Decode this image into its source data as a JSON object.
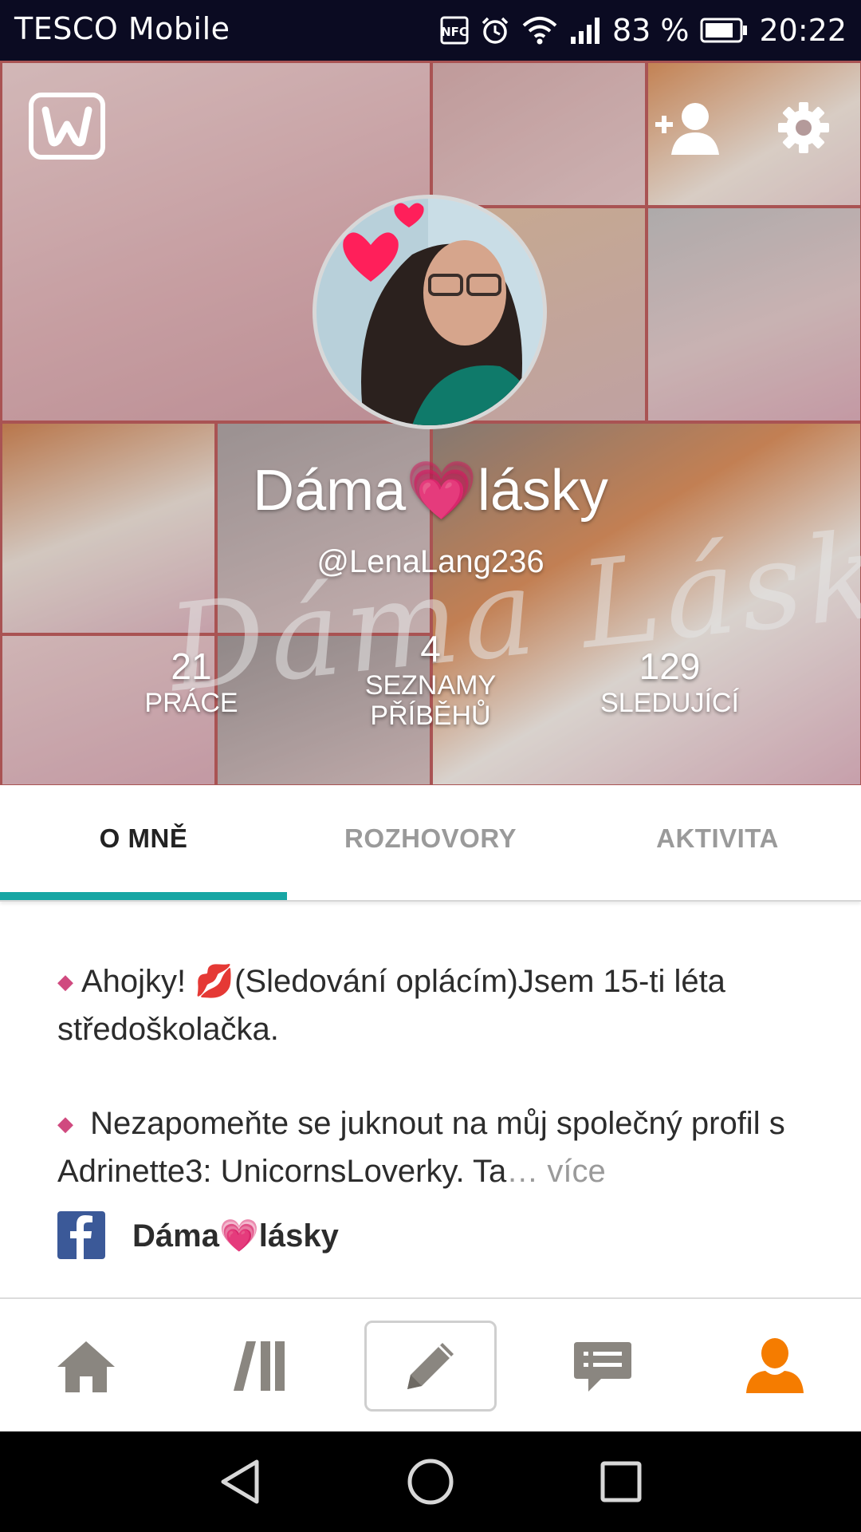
{
  "status_bar": {
    "carrier": "TESCO Mobile",
    "battery": "83 %",
    "time": "20:22",
    "icons": [
      "nfc-icon",
      "alarm-icon",
      "wifi-icon",
      "signal-icon",
      "battery-icon"
    ]
  },
  "header": {
    "logo_icon": "wattpad-logo-icon",
    "add_follow_icon": "add-user-icon",
    "settings_icon": "gear-icon",
    "display_name_prefix": "Dáma",
    "display_name_emoji": "💗",
    "display_name_suffix": "lásky",
    "username": "@LenaLang236",
    "cover_watermark": "Dáma Lásky"
  },
  "stats": [
    {
      "value": "21",
      "label": "PRÁCE"
    },
    {
      "value": "4",
      "label_line1": "SEZNAMY",
      "label_line2": "PŘÍBĚHŮ"
    },
    {
      "value": "129",
      "label": "SLEDUJÍCÍ"
    }
  ],
  "tabs": {
    "items": [
      {
        "label": "O MNĚ"
      },
      {
        "label": "ROZHOVORY"
      },
      {
        "label": "AKTIVITA"
      }
    ],
    "active_index": 0,
    "indicator_color": "#17a6a4"
  },
  "about": {
    "bullet": "◆",
    "paragraph1_start": "Ahojky! ",
    "paragraph1_emoji": "💋",
    "paragraph1_end": "(Sledování oplácím)Jsem 15-ti léta středoškolačka.",
    "paragraph2": " Nezapomeňte se juknout na můj společný profil s Adrinette3: UnicornsLoverky. Ta",
    "more_ellipsis": "…",
    "more_label": " více",
    "facebook": {
      "icon": "facebook-icon",
      "name_prefix": "Dáma",
      "name_emoji": "💗",
      "name_suffix": "lásky"
    }
  },
  "bottom_nav": {
    "items": [
      {
        "icon": "home-icon"
      },
      {
        "icon": "library-icon"
      },
      {
        "icon": "pencil-icon"
      },
      {
        "icon": "messages-icon"
      },
      {
        "icon": "profile-icon"
      }
    ],
    "active_color": "#f57c00",
    "inactive_color": "#8a8680"
  },
  "system_nav": {
    "items": [
      {
        "icon": "back-icon"
      },
      {
        "icon": "home-circle-icon"
      },
      {
        "icon": "recents-icon"
      }
    ]
  }
}
